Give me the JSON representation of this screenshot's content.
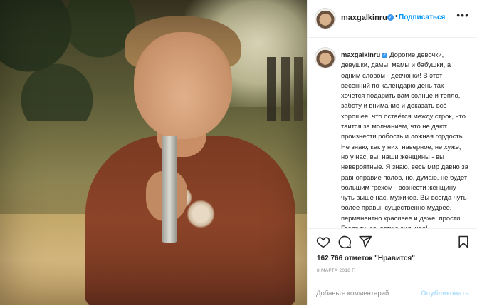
{
  "post": {
    "username": "maxgalkinru",
    "follow_label": "Подписаться",
    "separator": "•",
    "more_label": "•••",
    "caption": "Дорогие девочки, девушки, дамы, мамы и бабушки, а одним словом - девчонки! В этот весенний по календарю день так хочется подарить вам солнце и тепло, заботу и внимание и доказать всё хорошее, что остаётся между строк, что таится за молчанием, что не дают произнести робость и ложная гордость. Не знаю, как у них, наверное, не хуже, но у нас, вы, наши женщины - вы невероятные. Я знаю, весь мир давно за равноправие полов, но, думаю, не будет большим грехом - вознести женщину чуть выше нас, мужиков. Вы всегда чуть более правы, существенно мудрее, перманентно красивее и даже, прости Господи, зачастую сильнее!",
    "likes": "162 766 отметок \"Нравится\"",
    "date": "8 МАРТА 2018 Г.",
    "comment_placeholder": "Добавьте комментарий...",
    "publish_label": "Опубликовать"
  },
  "icons": {
    "verified": "verified-badge-icon",
    "like": "heart-icon",
    "comment": "comment-bubble-icon",
    "share": "paper-plane-icon",
    "save": "bookmark-icon"
  },
  "colors": {
    "accent": "#0095f6",
    "verified": "#3897f0",
    "muted": "#8e8e8e",
    "publish_disabled": "#b2dffc"
  }
}
